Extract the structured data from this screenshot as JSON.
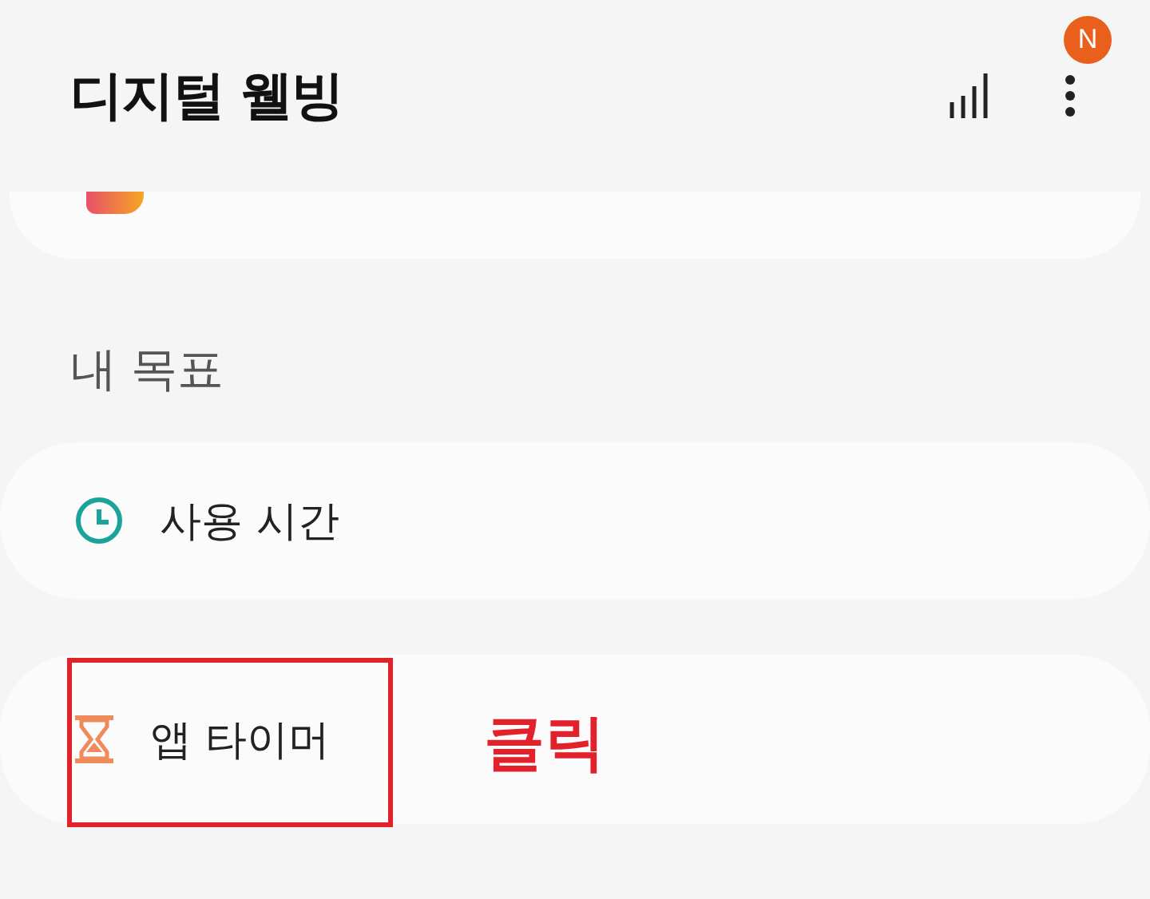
{
  "header": {
    "title": "디지털 웰빙",
    "menu_badge": "N"
  },
  "section": {
    "title": "내 목표"
  },
  "goals": [
    {
      "kind": "clock",
      "label": "사용 시간",
      "highlighted": false
    },
    {
      "kind": "timer",
      "label": "앱 타이머",
      "highlighted": true
    }
  ],
  "annotation": {
    "text": "클릭"
  }
}
